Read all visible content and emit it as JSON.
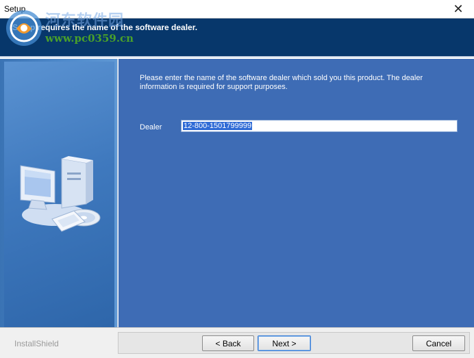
{
  "window": {
    "title": "Setup",
    "close_label": "✕"
  },
  "header": {
    "text": "Setup requires the name of the software dealer."
  },
  "watermark": {
    "chinese_text": "河东软件园",
    "url": "www.pc0359.cn"
  },
  "content": {
    "instruction": "Please enter the name of the software dealer which sold you this product.  The dealer information is required for support purposes.",
    "dealer_label": "Dealer",
    "dealer_value": "12-800-1501799999"
  },
  "footer": {
    "brand": "InstallShield",
    "back_label": "< Back",
    "next_label": "Next >",
    "cancel_label": "Cancel"
  },
  "colors": {
    "header_bg": "#07376b",
    "content_bg": "#3e6cb5",
    "selection": "#2f6bd6"
  },
  "icons": {
    "side_art": "computer-with-cd-icon",
    "watermark_logo": "pc0359-logo-icon"
  }
}
